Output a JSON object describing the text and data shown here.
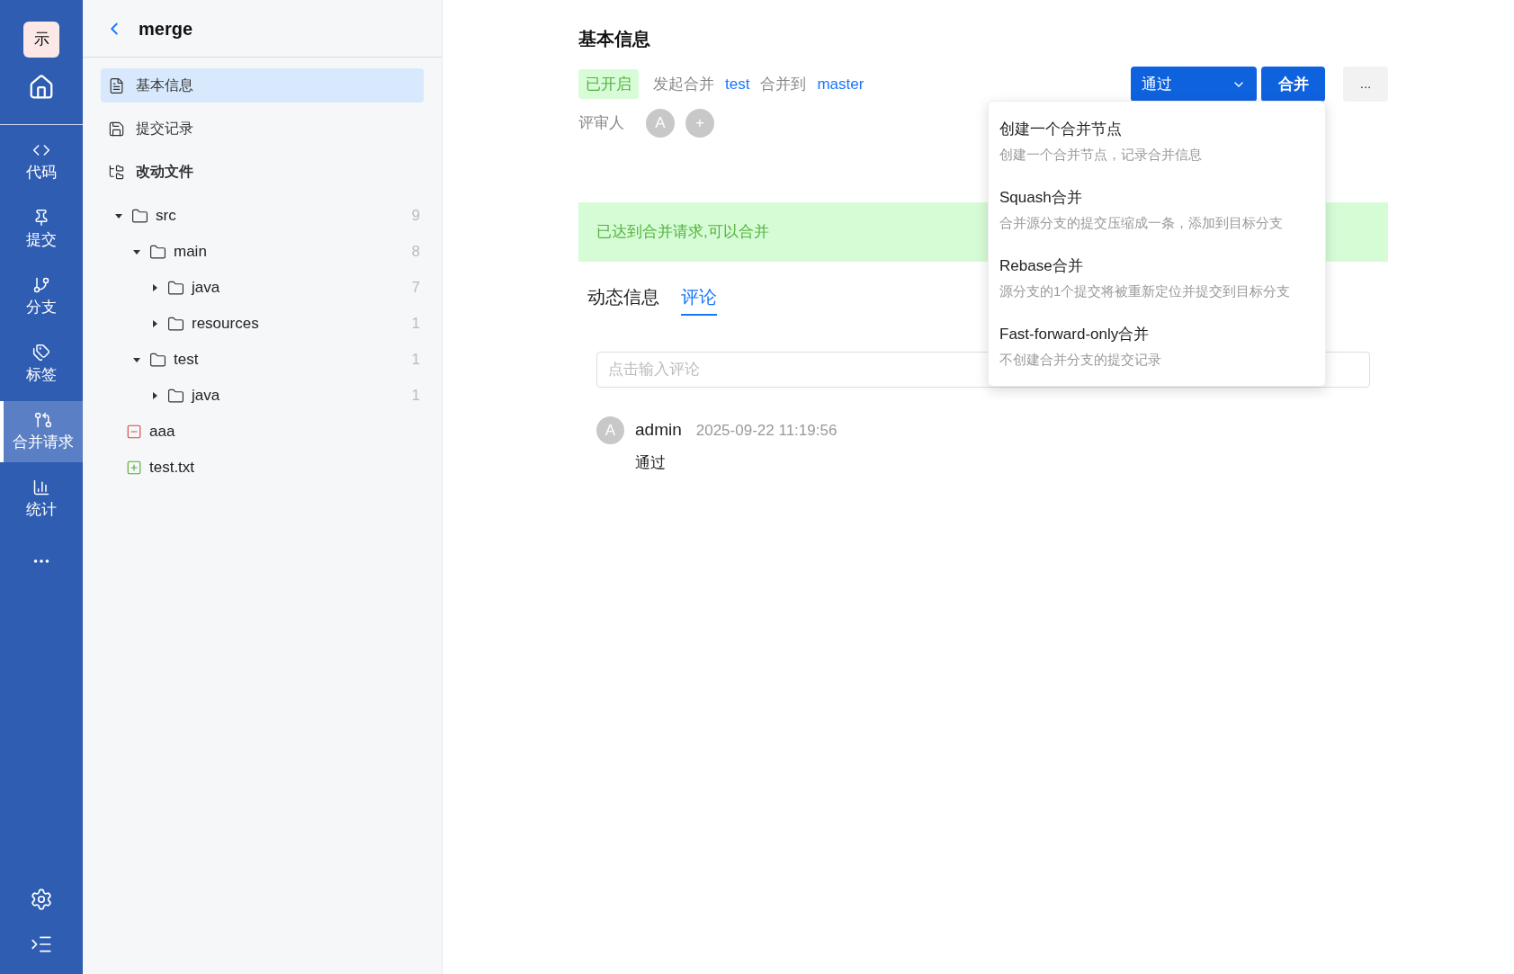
{
  "nav": {
    "logo": "示",
    "items": [
      {
        "selected": false
      },
      {
        "label": "代码",
        "selected": false
      },
      {
        "label": "提交",
        "selected": false
      },
      {
        "label": "分支",
        "selected": false
      },
      {
        "label": "标签",
        "selected": false
      },
      {
        "label": "合并请求",
        "selected": true
      },
      {
        "label": "统计",
        "selected": false
      }
    ]
  },
  "sidebar": {
    "title": "merge",
    "items": [
      {
        "label": "基本信息",
        "selected": true
      },
      {
        "label": "提交记录",
        "selected": false
      },
      {
        "label": "改动文件",
        "selected": false
      }
    ],
    "tree": [
      {
        "kind": "folder",
        "name": "src",
        "count": "9",
        "expanded": true,
        "children": [
          {
            "kind": "folder",
            "name": "main",
            "count": "8",
            "expanded": true,
            "children": [
              {
                "kind": "folder",
                "name": "java",
                "count": "7",
                "expanded": false
              },
              {
                "kind": "folder",
                "name": "resources",
                "count": "1",
                "expanded": false
              }
            ]
          },
          {
            "kind": "folder",
            "name": "test",
            "count": "1",
            "expanded": true,
            "children": [
              {
                "kind": "folder",
                "name": "java",
                "count": "1",
                "expanded": false
              }
            ]
          }
        ]
      },
      {
        "kind": "deleted",
        "name": "aaa"
      },
      {
        "kind": "added",
        "name": "test.txt"
      }
    ]
  },
  "main": {
    "title": "基本信息",
    "status": "已开启",
    "initiate": "发起合并",
    "source": "test",
    "merge_to": "合并到",
    "target": "master",
    "reviewer_label": "评审人",
    "reviewers": [
      "A"
    ],
    "add_reviewer": "+",
    "approve_button": "通过",
    "merge_button": "合并",
    "more_button": "...",
    "banner": "已达到合并请求,可以合并",
    "tabs": [
      {
        "label": "动态信息",
        "selected": false
      },
      {
        "label": "评论",
        "selected": true
      }
    ],
    "comment_input": {
      "placeholder": "点击输入评论"
    },
    "comments": [
      {
        "avatar": "A",
        "author": "admin",
        "time": "2025-09-22 11:19:56",
        "text": "通过"
      }
    ]
  },
  "merge_menu": [
    {
      "title": "创建一个合并节点",
      "desc": "创建一个合并节点，记录合并信息"
    },
    {
      "title": "Squash合并",
      "desc": "合并源分支的提交压缩成一条，添加到目标分支"
    },
    {
      "title": "Rebase合并",
      "desc": "源分支的1个提交将被重新定位并提交到目标分支"
    },
    {
      "title": "Fast-forward-only合并",
      "desc": "不创建合并分支的提交记录"
    }
  ]
}
